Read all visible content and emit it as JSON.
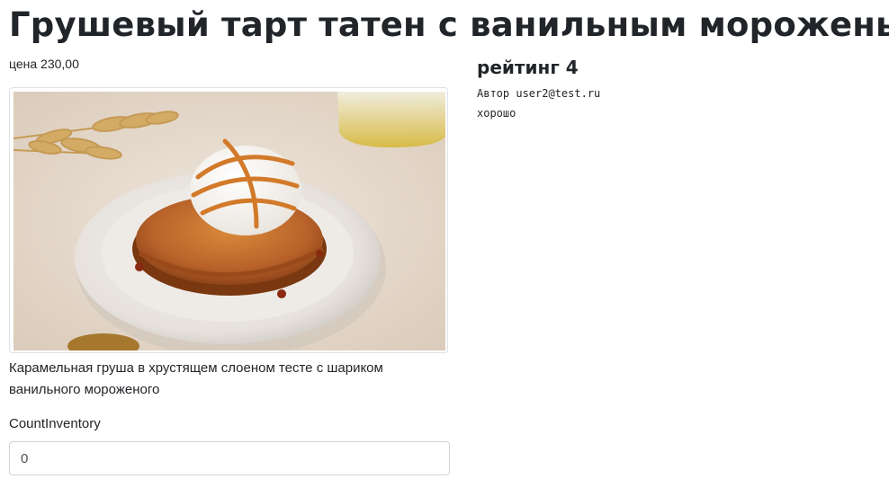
{
  "product": {
    "title": "Грушевый тарт татен с ванильным мороженым",
    "price": "цена 230,00",
    "description": "Карамельная груша в хрустящем слоеном тесте с шариком ванильного мороженого",
    "image_alt": "Тарт татен с шариком мороженого"
  },
  "review": {
    "rating": "рейтинг 4",
    "author": "Автор user2@test.ru",
    "text": "хорошо"
  },
  "inventory": {
    "label": "CountInventory",
    "value": "0"
  }
}
